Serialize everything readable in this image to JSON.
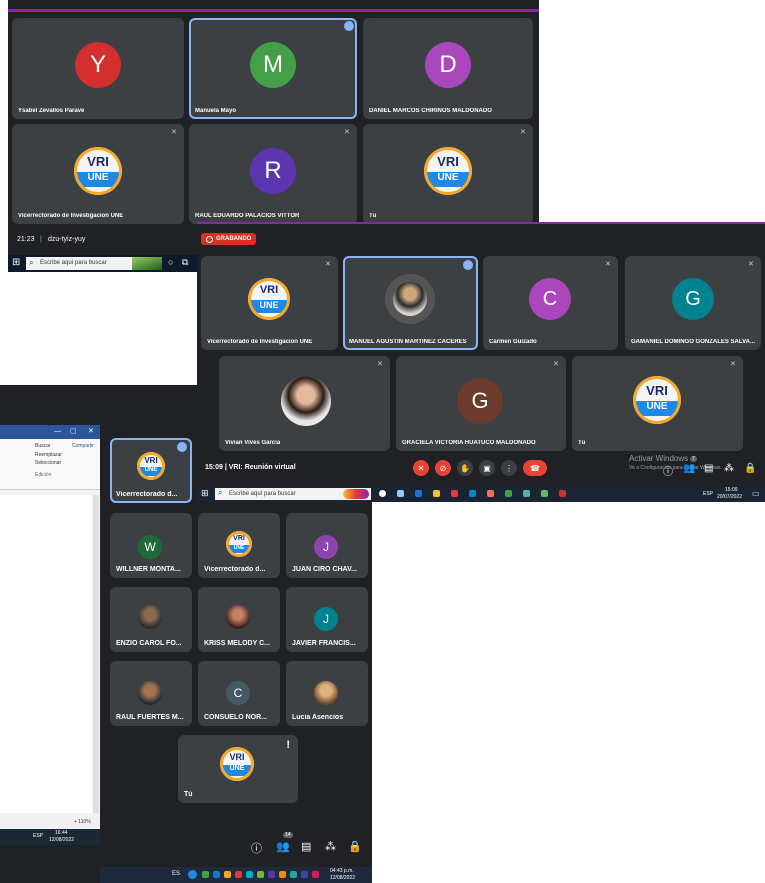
{
  "shot1": {
    "tiles": [
      {
        "name": "Ysabel Zevallos Paravé",
        "initial": "Y"
      },
      {
        "name": "Manuela Mayo",
        "initial": "M"
      },
      {
        "name": "DANIEL MARCOS CHIRINOS MALDONADO",
        "initial": "D"
      },
      {
        "name": "Vicerrectorado de Investigacion UNE"
      },
      {
        "name": "RAUL EDUARDO PALACIOS VITTOR",
        "initial": "R"
      },
      {
        "name": "Tú"
      }
    ],
    "time": "21:23",
    "meeting_code": "dzu-tyiz-yuy",
    "search_placeholder": "Escribe aquí para buscar"
  },
  "shot2": {
    "recording": "GRABANDO",
    "tiles": [
      {
        "name": "Vicerrectorado de Investigacion UNE"
      },
      {
        "name": "MANUEL AGUSTIN MARTINEZ CACERES"
      },
      {
        "name": "Carmen Guizado",
        "initial": "C"
      },
      {
        "name": "GAMANIEL DOMINGO GONZALES SALVA...",
        "initial": "G"
      },
      {
        "name": "Vivian Vives Garcia"
      },
      {
        "name": "GRACIELA VICTORIA HUATUCO MALDONADO",
        "initial": "G"
      },
      {
        "name": "Tú"
      }
    ],
    "meeting_info": "15:09 | VRI: Reunión virtual",
    "activate_title": "Activar Windows",
    "activate_sub": "Ve a Configuración para activar Windows.",
    "search_placeholder": "Escribe aquí para buscar",
    "clock_time": "15:09",
    "clock_date": "20/07/2022",
    "lang": "ESP",
    "participants_badge": "7"
  },
  "shot3": {
    "word": {
      "share_label": "Compartir",
      "find_label": "Buscar",
      "replace_label": "Reemplazar",
      "select_label": "Seleccionar",
      "editing_label": "Edición",
      "zoom": "+ 110%",
      "lang": "ESP",
      "clock_time": "16:44",
      "clock_date": "12/08/2022"
    },
    "tiles": [
      {
        "name": "Vicerrectorado d..."
      },
      {
        "name": "WILLNER MONTA...",
        "initial": "W"
      },
      {
        "name": "Vicerrectorado d..."
      },
      {
        "name": "JUAN CIRO CHAV...",
        "initial": "J"
      },
      {
        "name": "ENZIO CAROL FO..."
      },
      {
        "name": "KRISS MELODY C..."
      },
      {
        "name": "JAVIER FRANCIS...",
        "initial": "J"
      },
      {
        "name": "RAUL FUERTES M..."
      },
      {
        "name": "CONSUELO NOR...",
        "initial": "C"
      },
      {
        "name": "Lucia Asencios"
      },
      {
        "name": "Tú"
      }
    ],
    "participants_badge": "14",
    "lang": "ES",
    "clock_time": "04:43 p.m.",
    "clock_date": "12/08/2022"
  },
  "colors": {
    "meet_bg": "#202124",
    "tile_bg": "#3c4043",
    "active_border": "#8ab4f8",
    "red": "#ea4335",
    "purple_top": "#8e24aa"
  }
}
